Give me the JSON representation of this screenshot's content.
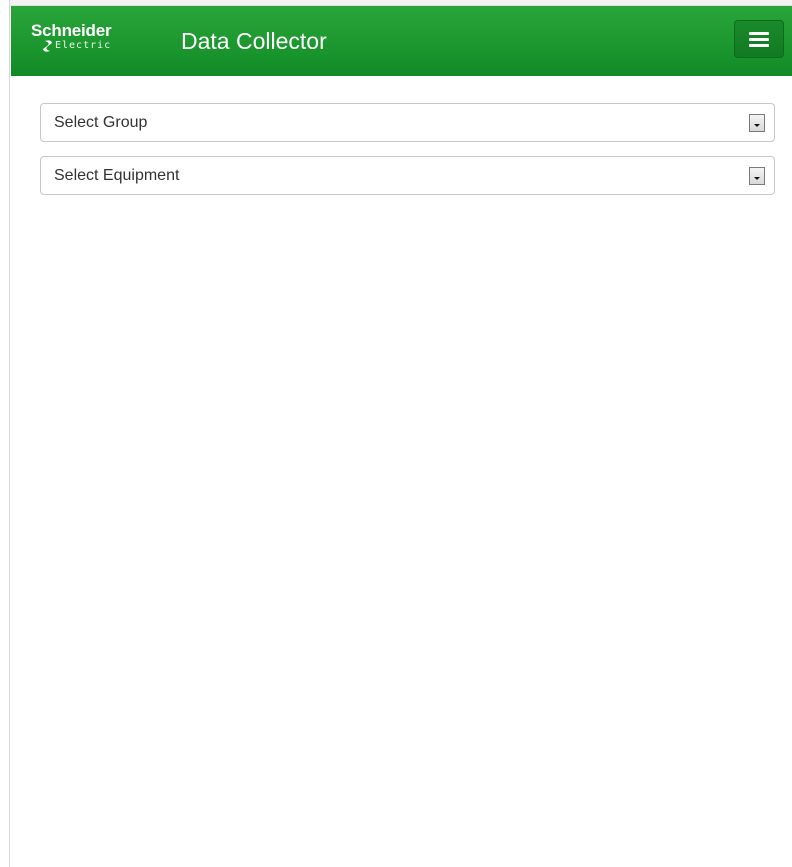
{
  "header": {
    "brand_name": "Schneider",
    "brand_sub": "Electric",
    "app_title": "Data Collector",
    "accent_color": "#1f9a31"
  },
  "filters": [
    {
      "label": "Select Group",
      "icon": "dropdown-arrow-icon"
    },
    {
      "label": "Select Equipment",
      "icon": "dropdown-arrow-icon"
    }
  ],
  "menu": {
    "icon": "hamburger-menu-icon"
  }
}
